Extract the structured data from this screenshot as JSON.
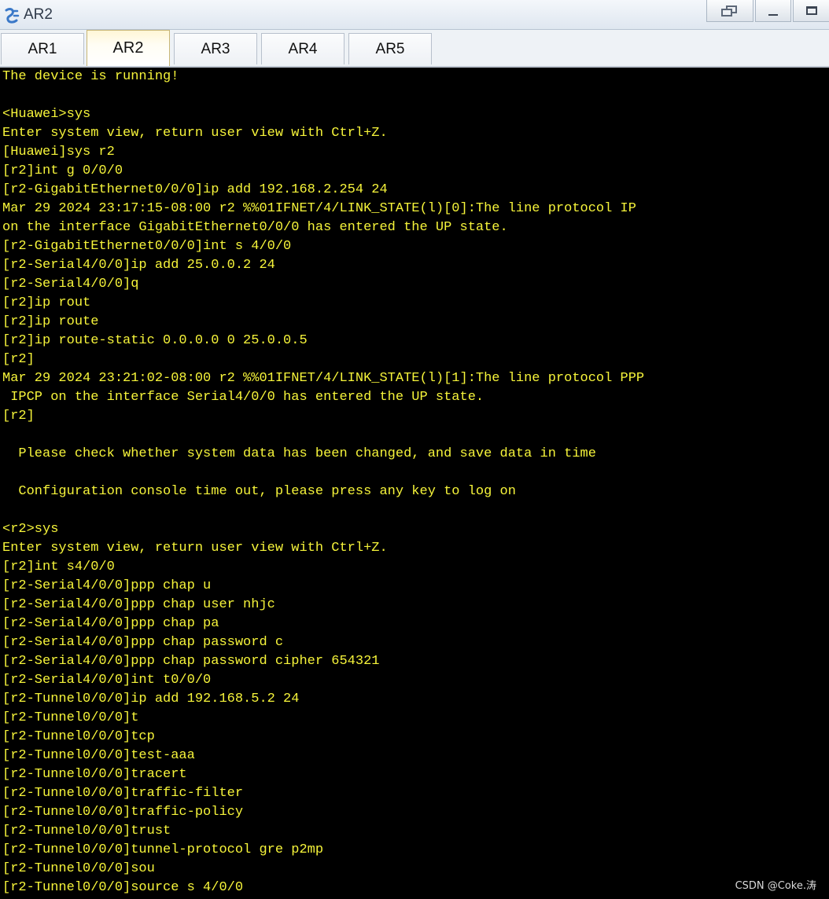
{
  "window": {
    "title": "AR2",
    "icon": "router-app-icon"
  },
  "tabs": [
    {
      "label": "AR1",
      "active": false
    },
    {
      "label": "AR2",
      "active": true
    },
    {
      "label": "AR3",
      "active": false
    },
    {
      "label": "AR4",
      "active": false
    },
    {
      "label": "AR5",
      "active": false
    }
  ],
  "terminal": {
    "text_color": "#f6f43a",
    "background": "#000000",
    "lines": [
      "The device is running!",
      "",
      "<Huawei>sys",
      "Enter system view, return user view with Ctrl+Z.",
      "[Huawei]sys r2",
      "[r2]int g 0/0/0",
      "[r2-GigabitEthernet0/0/0]ip add 192.168.2.254 24",
      "Mar 29 2024 23:17:15-08:00 r2 %%01IFNET/4/LINK_STATE(l)[0]:The line protocol IP",
      "on the interface GigabitEthernet0/0/0 has entered the UP state.",
      "[r2-GigabitEthernet0/0/0]int s 4/0/0",
      "[r2-Serial4/0/0]ip add 25.0.0.2 24",
      "[r2-Serial4/0/0]q",
      "[r2]ip rout",
      "[r2]ip route",
      "[r2]ip route-static 0.0.0.0 0 25.0.0.5",
      "[r2]",
      "Mar 29 2024 23:21:02-08:00 r2 %%01IFNET/4/LINK_STATE(l)[1]:The line protocol PPP",
      " IPCP on the interface Serial4/0/0 has entered the UP state.",
      "[r2]",
      "",
      "  Please check whether system data has been changed, and save data in time",
      "",
      "  Configuration console time out, please press any key to log on",
      "",
      "<r2>sys",
      "Enter system view, return user view with Ctrl+Z.",
      "[r2]int s4/0/0",
      "[r2-Serial4/0/0]ppp chap u",
      "[r2-Serial4/0/0]ppp chap user nhjc",
      "[r2-Serial4/0/0]ppp chap pa",
      "[r2-Serial4/0/0]ppp chap password c",
      "[r2-Serial4/0/0]ppp chap password cipher 654321",
      "[r2-Serial4/0/0]int t0/0/0",
      "[r2-Tunnel0/0/0]ip add 192.168.5.2 24",
      "[r2-Tunnel0/0/0]t",
      "[r2-Tunnel0/0/0]tcp",
      "[r2-Tunnel0/0/0]test-aaa",
      "[r2-Tunnel0/0/0]tracert",
      "[r2-Tunnel0/0/0]traffic-filter",
      "[r2-Tunnel0/0/0]traffic-policy",
      "[r2-Tunnel0/0/0]trust",
      "[r2-Tunnel0/0/0]tunnel-protocol gre p2mp",
      "[r2-Tunnel0/0/0]sou",
      "[r2-Tunnel0/0/0]source s 4/0/0"
    ]
  },
  "watermark": "CSDN @Coke.涛"
}
